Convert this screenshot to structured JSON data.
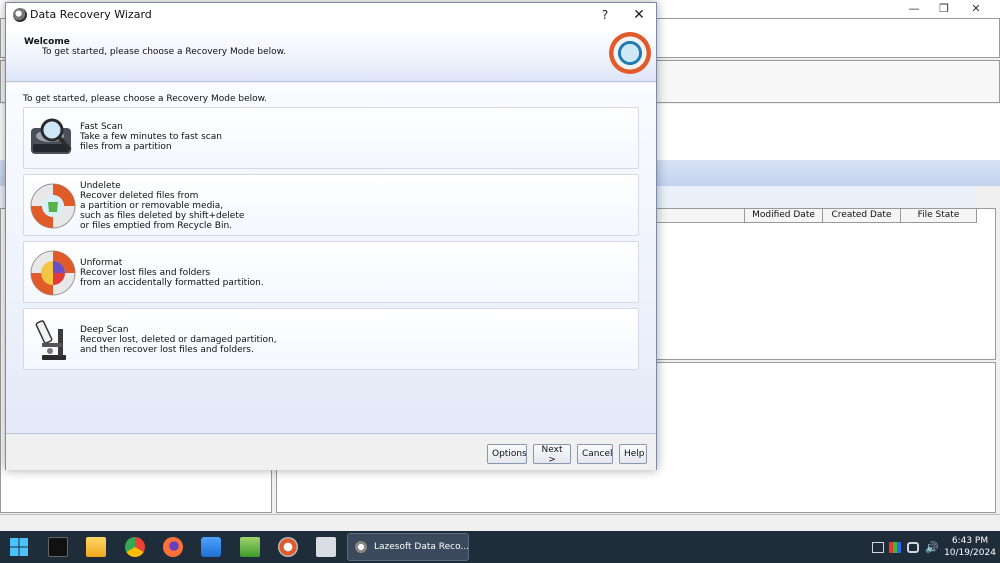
{
  "background_window": {
    "controls": {
      "minimize": "—",
      "maximize": "❐",
      "close": "✕"
    },
    "file_columns": [
      "Modified Date",
      "Created Date",
      "File State"
    ]
  },
  "wizard": {
    "title": "Data Recovery Wizard",
    "help_glyph": "?",
    "close_glyph": "✕",
    "header": {
      "title": "Welcome",
      "subtitle": "To get started, please choose a Recovery Mode below."
    },
    "body_intro": "To get started, please choose a Recovery Mode below.",
    "modes": [
      {
        "title": "Fast Scan",
        "lines": [
          "Take a few minutes to fast scan",
          "files from a partition"
        ],
        "icon": "drive-magnifier-icon"
      },
      {
        "title": "Undelete",
        "lines": [
          "Recover deleted files from",
          "a partition or removable media,",
          "such as files deleted by shift+delete",
          "or files emptied from Recycle Bin."
        ],
        "icon": "lifebuoy-recycle-icon"
      },
      {
        "title": "Unformat",
        "lines": [
          "Recover lost files and folders",
          "from an accidentally formatted partition."
        ],
        "icon": "lifebuoy-pie-icon"
      },
      {
        "title": "Deep Scan",
        "lines": [
          "Recover lost, deleted or damaged partition,",
          "and then recover lost files and folders."
        ],
        "icon": "microscope-icon"
      }
    ],
    "buttons": {
      "options": "Options",
      "next": "Next >",
      "cancel": "Cancel",
      "help": "Help"
    }
  },
  "taskbar": {
    "active_app_label": "Lazesoft Data Reco...",
    "volume_glyph": "🔊",
    "time": "6:43 PM",
    "date": "10/19/2024"
  }
}
